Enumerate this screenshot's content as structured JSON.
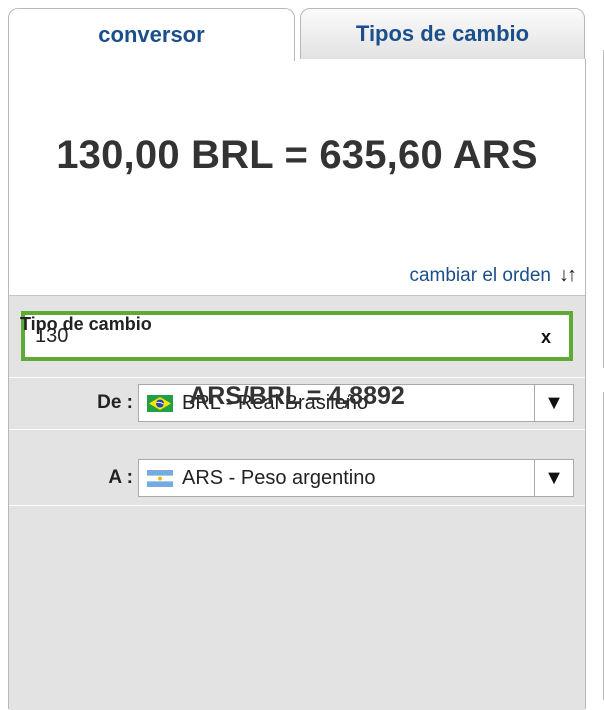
{
  "tabs": {
    "converter_label": "conversor",
    "rates_label": "Tipos de cambio"
  },
  "result": {
    "text": "130,00 BRL = 635,60 ARS"
  },
  "swap": {
    "label": "cambiar el orden",
    "arrows": "↓↑"
  },
  "amount_input": {
    "value": "130",
    "clear_label": "x"
  },
  "from": {
    "label": "De :",
    "value": "BRL - Real Brasileño",
    "flag": "brazil-flag-icon"
  },
  "to": {
    "label": "A :",
    "value": "ARS - Peso argentino",
    "flag": "argentina-flag-icon"
  },
  "dropdown_arrow": "▼",
  "rate": {
    "title": "Tipo de cambio",
    "value": "ARS/BRL = 4,8892"
  },
  "colors": {
    "accent_blue": "#1a4f8b",
    "input_border_green": "#5daa34",
    "panel_gray": "#e3e3e3"
  }
}
